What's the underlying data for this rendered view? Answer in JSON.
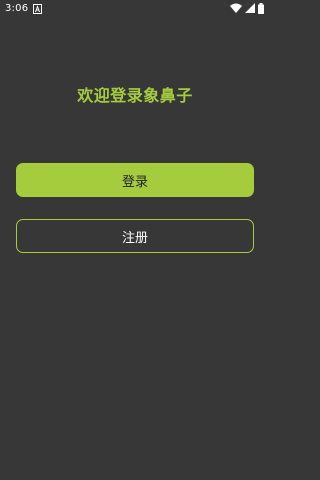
{
  "status_bar": {
    "time": "3:06",
    "notification_icon": "a-notification-icon",
    "wifi_icon": "wifi-icon",
    "signal_icon": "cell-signal-icon",
    "battery_icon": "battery-icon"
  },
  "main": {
    "welcome_text": "欢迎登录象鼻子",
    "login_label": "登录",
    "register_label": "注册"
  },
  "colors": {
    "background": "#373737",
    "accent": "#a4cc3d"
  }
}
